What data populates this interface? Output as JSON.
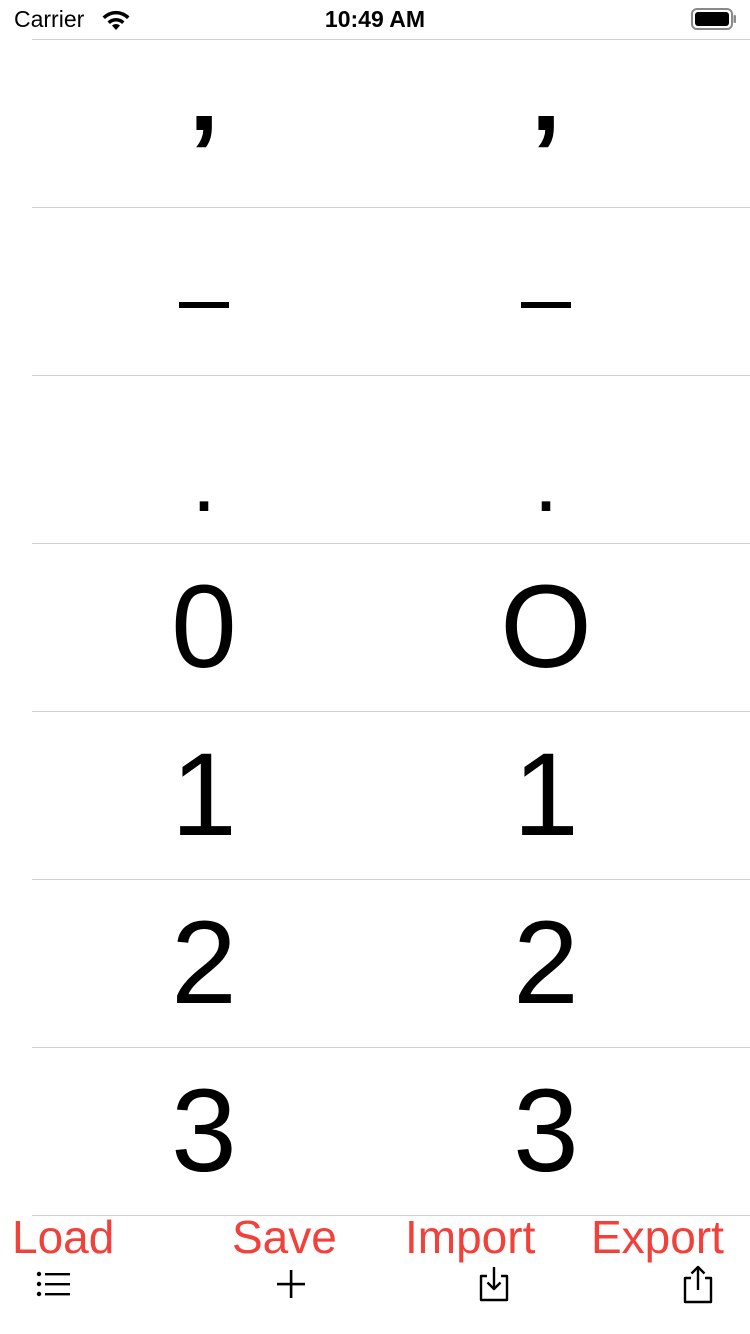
{
  "status_bar": {
    "carrier": "Carrier",
    "time": "10:49 AM"
  },
  "rows": [
    {
      "left": "’",
      "right": "’",
      "style": "slash"
    },
    {
      "left": "–",
      "right": "–",
      "style": "dash"
    },
    {
      "left": ".",
      "right": ".",
      "style": "dot"
    },
    {
      "left": "0",
      "right": "O",
      "style": "num"
    },
    {
      "left": "1",
      "right": "1",
      "style": "num"
    },
    {
      "left": "2",
      "right": "2",
      "style": "num"
    },
    {
      "left": "3",
      "right": "3",
      "style": "num"
    }
  ],
  "toolbar": {
    "load_label": "Load",
    "save_label": "Save",
    "import_label": "Import",
    "export_label": "Export",
    "load_icon": "list-icon",
    "save_icon": "plus-icon",
    "import_icon": "tray-download-icon",
    "export_icon": "share-icon"
  },
  "colors": {
    "accent": "#f2403a",
    "divider": "#cfcfcf",
    "text": "#000000"
  }
}
